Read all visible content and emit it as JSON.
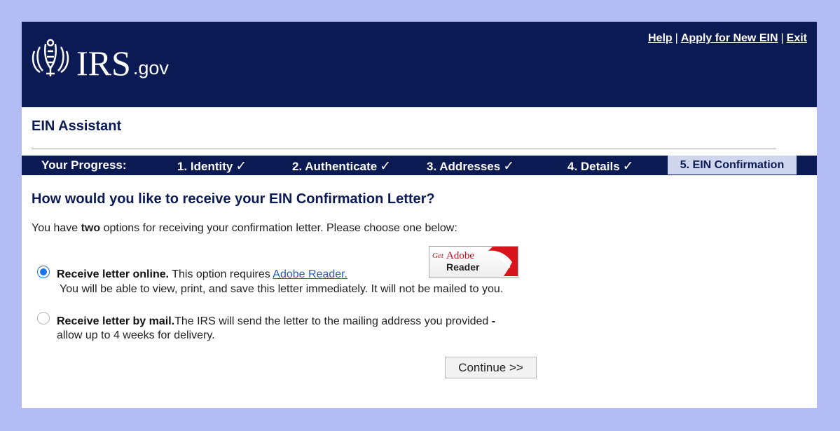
{
  "header": {
    "logo_text": "IRS",
    "logo_suffix": ".gov",
    "links": {
      "help": "Help",
      "apply": "Apply for New EIN",
      "exit": "Exit",
      "separator": "|"
    }
  },
  "assistant_title": "EIN Assistant",
  "progress": {
    "label": "Your Progress:",
    "steps": [
      {
        "label": "1. Identity",
        "done": true
      },
      {
        "label": "2. Authenticate",
        "done": true
      },
      {
        "label": "3. Addresses",
        "done": true
      },
      {
        "label": "4. Details",
        "done": true
      },
      {
        "label": "5. EIN Confirmation",
        "current": true
      }
    ],
    "check": "✓"
  },
  "question": "How would you like to receive your EIN Confirmation Letter?",
  "intro": {
    "before": "You have ",
    "bold": "two",
    "after": " options for receiving your confirmation letter. Please choose one below:"
  },
  "options": [
    {
      "checked": true,
      "title": "Receive letter online.",
      "text": " This option requires ",
      "link": "Adobe Reader.",
      "line2": "You will be able to view, print, and save this letter immediately. It will not be mailed to you."
    },
    {
      "checked": false,
      "title": "Receive letter by mail.",
      "text": "The IRS will send the letter to the mailing address you provided ",
      "bold_dash": "-",
      "line2": "allow up to 4 weeks for delivery."
    }
  ],
  "adobe_badge": {
    "get": "Get",
    "adobe": "Adobe",
    "reader": "Reader"
  },
  "continue_label": "Continue >>",
  "colors": {
    "navy": "#0b1a53",
    "background": "#b3bcf5",
    "current_step": "#cfd6ee",
    "radio_blue": "#1a73e8"
  }
}
